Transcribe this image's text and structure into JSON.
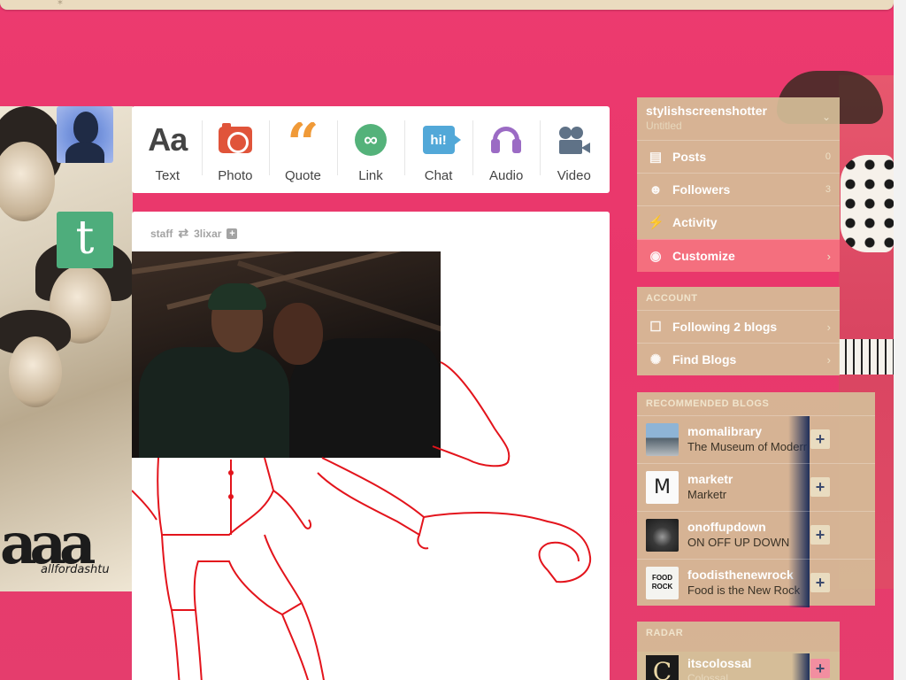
{
  "composer": {
    "types": [
      {
        "label": "Text",
        "icon": "Aa"
      },
      {
        "label": "Photo",
        "icon": "camera-icon"
      },
      {
        "label": "Quote",
        "icon": "“"
      },
      {
        "label": "Link",
        "icon": "∞"
      },
      {
        "label": "Chat",
        "icon": "hi!"
      },
      {
        "label": "Audio",
        "icon": "headphones-icon"
      },
      {
        "label": "Video",
        "icon": "video-camera-icon"
      }
    ]
  },
  "post": {
    "author": "staff",
    "reblog_icon": "⇄",
    "source": "3lixar",
    "follow_icon": "+"
  },
  "sidebar": {
    "blog": {
      "name": "stylishscreenshotter",
      "title": "Untitled"
    },
    "rows": [
      {
        "label": "Posts",
        "icon": "▤",
        "count": "0"
      },
      {
        "label": "Followers",
        "icon": "👥",
        "count": "3"
      },
      {
        "label": "Activity",
        "icon": "⚡",
        "count": ""
      },
      {
        "label": "Customize",
        "icon": "◉",
        "chevron": "›"
      }
    ],
    "account": {
      "header": "ACCOUNT",
      "rows": [
        {
          "label": "Following 2 blogs",
          "icon": "☐",
          "chevron": "›"
        },
        {
          "label": "Find Blogs",
          "icon": "✺",
          "chevron": "›"
        }
      ]
    },
    "recommended": {
      "header": "RECOMMENDED BLOGS",
      "blogs": [
        {
          "name": "momalibrary",
          "desc": "The Museum of Modern Art Library",
          "avatar_text": ""
        },
        {
          "name": "marketr",
          "desc": "Marketr",
          "avatar_text": "M"
        },
        {
          "name": "onoffupdown",
          "desc": "ON OFF UP DOWN",
          "avatar_text": ""
        },
        {
          "name": "foodisthenewrock",
          "desc": "Food is the New Rock",
          "avatar_text": "FOOD ROCK"
        }
      ],
      "add_label": "+"
    },
    "radar": {
      "header": "RADAR",
      "item": {
        "name": "itscolossal",
        "desc": "Colossal",
        "avatar_text": "C",
        "add_label": "+"
      }
    }
  },
  "background": {
    "left_script": "aaa",
    "left_caption": "allfordashtu"
  },
  "colors": {
    "page_bg": "#ec3a6f",
    "sidebar_bg": "#d5be98",
    "active_row": "#f46f7e",
    "drawing_stroke": "#e3141c"
  }
}
